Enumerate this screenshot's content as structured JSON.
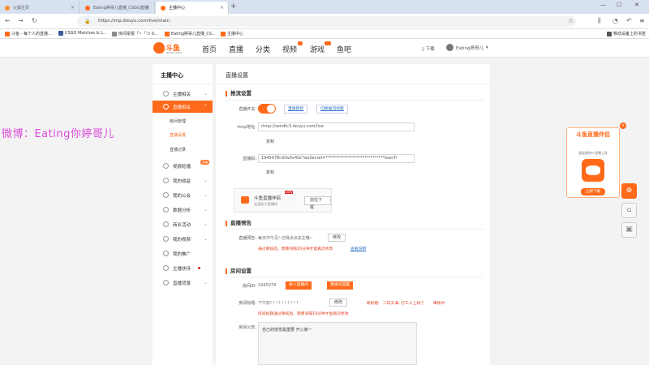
{
  "browser": {
    "tabs": [
      {
        "label": "火狐主页",
        "active": false
      },
      {
        "label": "Eating婷哥儿直播_CSGO直播",
        "active": false
      },
      {
        "label": "主播中心",
        "active": true
      }
    ],
    "url": "https://mp.douyu.com/live/main",
    "bookmarks": [
      "斗鱼 - 每个人的直播...",
      "CSGO Matches & L...",
      "房间举报「~「つ 0...",
      "Eating婷哥儿直播_CS...",
      "主播中心"
    ],
    "mobile_bookmarks": "移动设备上的书签"
  },
  "site": {
    "logo_name": "斗鱼",
    "logo_domain": "douyu.com",
    "nav": [
      "首页",
      "直播",
      "分类",
      "视频",
      "游戏",
      "鱼吧"
    ],
    "download": "下载",
    "username": "Eating婷哥儿"
  },
  "sidebar": {
    "title": "主播中心",
    "items": [
      "主播相关",
      "直播相关",
      "视频轮播",
      "我的收益",
      "我的公会",
      "数据分析",
      "商业活动",
      "我的视频",
      "我的推广",
      "主播扶持",
      "直播背景"
    ],
    "sub_items": [
      "房间管理",
      "直播设置",
      "直播记录"
    ],
    "badge": "直播"
  },
  "main": {
    "title": "直播设置",
    "stream": {
      "section": "推流设置",
      "switch_label": "直播开关:",
      "link1": "直播教程",
      "link2": "切换推流线路",
      "rtmp_label": "rtmp地址:",
      "rtmp_value": "rtmp://sendtc3.douyu.com/live",
      "copy": "复制",
      "code_label": "直播码:",
      "code_value": "1945078rzDwSv4Gr?wsSecret=*****************************&wsTi",
      "promo_title": "斗鱼直播伴侣",
      "promo_sub": "全面助力直播间",
      "promo_new": "NEW",
      "promo_download": "前往下载"
    },
    "notice": {
      "section": "直播预告",
      "label": "直播预告:",
      "value": "每天中午见! 记得点点关注哦~",
      "edit": "修改",
      "warn": "通过审核后，需要间隔10分钟才能再次修改",
      "link": "查看说明"
    },
    "room": {
      "section": "房间设置",
      "id_label": "房间ID:",
      "id_value": "1945078",
      "btn_enter": "进入直播间",
      "btn_quit": "直播间提醒",
      "title_label": "房间标题:",
      "title_value": "下午好! ! ! ! ! ! ! ! ! !",
      "edit": "修改",
      "new_title_label": "新标题:",
      "new_title_value": "二白天海: 打工人上线了",
      "review": "审核中",
      "warn": "房间标题通过审核后，需要间隔10分钟才能再次修改",
      "announce_label": "房间公告:",
      "announce_value": "自己的感觉最重要 开心第一"
    }
  },
  "overlay": {
    "watermark": "微博：Eating你婷哥儿"
  },
  "ad": {
    "title": "斗鱼直播伴侣",
    "sub": "超轻便的PC直播工具",
    "button": "立即下载"
  },
  "colors": {
    "accent": "#ff6a1a",
    "link": "#2f70c8",
    "warn": "#e03c1f"
  }
}
